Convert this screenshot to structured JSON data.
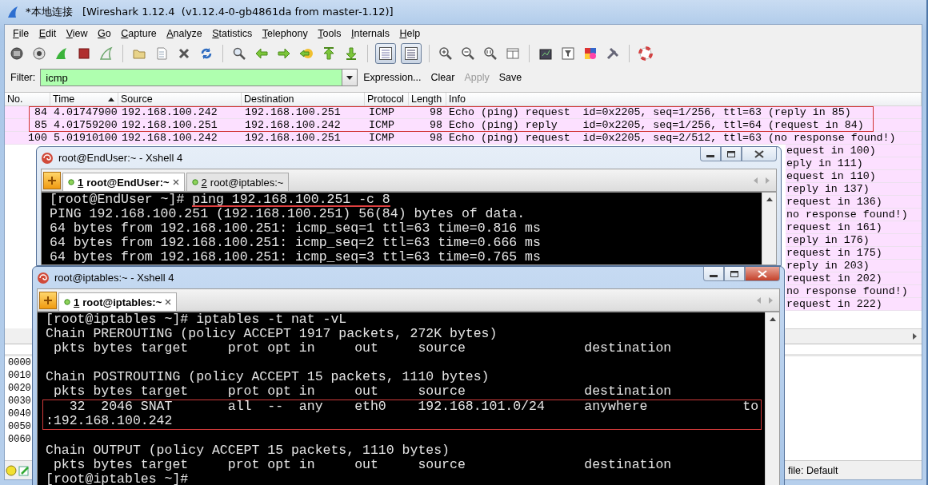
{
  "wireshark": {
    "title": "*本地连接   [Wireshark 1.12.4  (v1.12.4-0-gb4861da from master-1.12)]",
    "menu": [
      "File",
      "Edit",
      "View",
      "Go",
      "Capture",
      "Analyze",
      "Statistics",
      "Telephony",
      "Tools",
      "Internals",
      "Help"
    ],
    "toolbar_toggles": [
      {
        "pressed": true
      },
      {
        "pressed": true
      }
    ],
    "filter": {
      "label": "Filter:",
      "value": "icmp",
      "valid": true,
      "buttons": [
        {
          "label": "Expression...",
          "disabled": false
        },
        {
          "label": "Clear",
          "disabled": false
        },
        {
          "label": "Apply",
          "disabled": true
        },
        {
          "label": "Save",
          "disabled": false
        }
      ]
    },
    "columns": [
      {
        "label": "No.",
        "sorted": false
      },
      {
        "label": "Time",
        "sorted": true
      },
      {
        "label": "Source",
        "sorted": false
      },
      {
        "label": "Destination",
        "sorted": false
      },
      {
        "label": "Protocol",
        "sorted": false
      },
      {
        "label": "Length",
        "sorted": false
      },
      {
        "label": "Info",
        "sorted": false
      }
    ],
    "packets": [
      {
        "no": "84",
        "time": "4.01747900",
        "source": "192.168.100.242",
        "destination": "192.168.100.251",
        "protocol": "ICMP",
        "length": "98",
        "info": "Echo (ping) request  id=0x2205, seq=1/256, ttl=63 (reply in 85)",
        "boxed": true
      },
      {
        "no": "85",
        "time": "4.01759200",
        "source": "192.168.100.251",
        "destination": "192.168.100.242",
        "protocol": "ICMP",
        "length": "98",
        "info": "Echo (ping) reply    id=0x2205, seq=1/256, ttl=64 (request in 84)",
        "boxed": true
      },
      {
        "no": "100",
        "time": "5.01910100",
        "source": "192.168.100.242",
        "destination": "192.168.100.251",
        "protocol": "ICMP",
        "length": "98",
        "info": "Echo (ping) request  id=0x2205, seq=2/512, ttl=63 (no response found!)",
        "boxed": false
      }
    ],
    "packets_partial": [
      {
        "info": "equest in 100)"
      },
      {
        "info": "eply in 111)"
      },
      {
        "info": "equest in 110)"
      },
      {
        "info": "reply in 137)"
      },
      {
        "info": "request in 136)"
      },
      {
        "info": "no response found!)"
      },
      {
        "info": "request in 161)"
      },
      {
        "info": "reply in 176)"
      },
      {
        "info": "request in 175)"
      },
      {
        "info": "reply in 203)"
      },
      {
        "info": "request in 202)"
      },
      {
        "info": "no response found!)"
      },
      {
        "info": "request in 222)"
      }
    ],
    "hex_offsets": [
      "0000",
      "0010",
      "0020",
      "0030",
      "0040",
      "0050",
      "0060"
    ],
    "status_profile": "file: Default"
  },
  "xshell_windows": [
    {
      "title": "root@EndUser:~ - Xshell 4",
      "active": false,
      "tabs": [
        {
          "number": "1",
          "label": "root@EndUser:~",
          "selected": true
        },
        {
          "number": "2",
          "label": "root@iptables:~",
          "selected": false
        }
      ],
      "lines": [
        {
          "kind": "prompt",
          "prompt": "[root@EndUser ~]# ",
          "command": "ping 192.168.100.251 -c 8",
          "underlined": true
        },
        {
          "kind": "output",
          "text": "PING 192.168.100.251 (192.168.100.251) 56(84) bytes of data.",
          "boxed": false
        },
        {
          "kind": "output",
          "text": "64 bytes from 192.168.100.251: icmp_seq=1 ttl=63 time=0.816 ms",
          "boxed": false
        },
        {
          "kind": "output",
          "text": "64 bytes from 192.168.100.251: icmp_seq=2 ttl=63 time=0.666 ms",
          "boxed": false
        },
        {
          "kind": "output",
          "text": "64 bytes from 192.168.100.251: icmp_seq=3 ttl=63 time=0.765 ms",
          "boxed": false
        }
      ]
    },
    {
      "title": "root@iptables:~ - Xshell 4",
      "active": true,
      "tabs": [
        {
          "number": "1",
          "label": "root@iptables:~",
          "selected": true
        }
      ],
      "lines": [
        {
          "kind": "prompt",
          "prompt": "[root@iptables ~]# ",
          "command": "iptables -t nat -vL",
          "underlined": false
        },
        {
          "kind": "output",
          "text": "Chain PREROUTING (policy ACCEPT 1917 packets, 272K bytes)",
          "boxed": false
        },
        {
          "kind": "output",
          "text": " pkts bytes target     prot opt in     out     source               destination",
          "boxed": false
        },
        {
          "kind": "blank"
        },
        {
          "kind": "output",
          "text": "Chain POSTROUTING (policy ACCEPT 15 packets, 1110 bytes)",
          "boxed": false
        },
        {
          "kind": "output",
          "text": " pkts bytes target     prot opt in     out     source               destination",
          "boxed": false
        },
        {
          "kind": "output",
          "text": "   32  2046 SNAT       all  --  any    eth0    192.168.101.0/24     anywhere            to",
          "boxed": true
        },
        {
          "kind": "output",
          "text": ":192.168.100.242",
          "boxed": true
        },
        {
          "kind": "blank"
        },
        {
          "kind": "output",
          "text": "Chain OUTPUT (policy ACCEPT 15 packets, 1110 bytes)",
          "boxed": false
        },
        {
          "kind": "output",
          "text": " pkts bytes target     prot opt in     out     source               destination",
          "boxed": false
        },
        {
          "kind": "prompt",
          "prompt": "[root@iptables ~]# "
        }
      ]
    }
  ]
}
